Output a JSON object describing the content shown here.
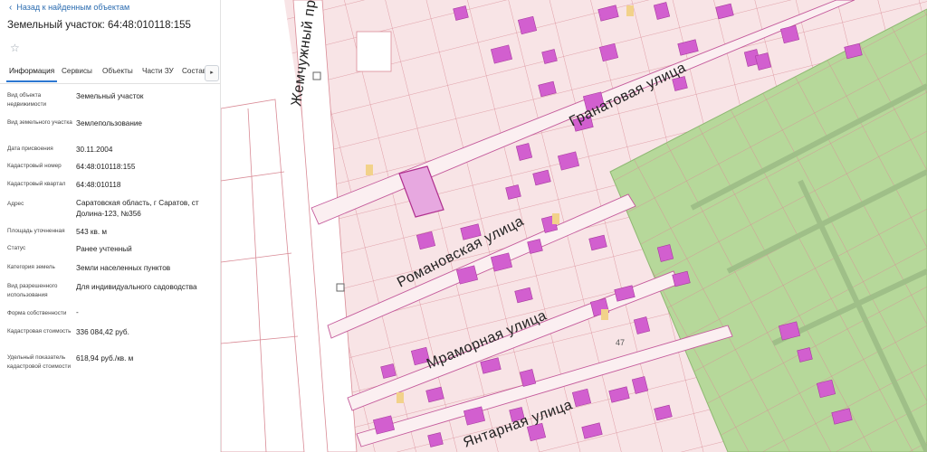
{
  "nav": {
    "back_label": "Назад к найденным объектам"
  },
  "header": {
    "title": "Земельный участок: 64:48:010118:155",
    "favorite_icon": "star-icon"
  },
  "tabs": [
    {
      "label": "Информация",
      "active": true
    },
    {
      "label": "Сервисы"
    },
    {
      "label": "Объекты"
    },
    {
      "label": "Части ЗУ"
    },
    {
      "label": "Состав"
    }
  ],
  "tabs_scroll_icon": "chevron-right-icon",
  "info": {
    "object_type": {
      "label": "Вид объекта недвижимости",
      "value": "Земельный участок"
    },
    "land_type": {
      "label": "Вид земельного участка",
      "value": "Землепользование"
    },
    "assign_date": {
      "label": "Дата присвоения",
      "value": "30.11.2004"
    },
    "cad_number": {
      "label": "Кадастровый номер",
      "value": "64:48:010118:155"
    },
    "cad_quarter": {
      "label": "Кадастровый квартал",
      "value": "64:48:010118"
    },
    "address": {
      "label": "Адрес",
      "value": "Саратовская область, г Саратов, ст Долина-123, №356"
    },
    "area": {
      "label": "Площадь уточненная",
      "value": "543 кв. м"
    },
    "status": {
      "label": "Статус",
      "value": "Ранее учтенный"
    },
    "land_category": {
      "label": "Категория земель",
      "value": "Земли населенных пунктов"
    },
    "permitted_use": {
      "label": "Вид разрешенного использования",
      "value": "Для индивидуального садоводства"
    },
    "ownership_form": {
      "label": "Форма собственности",
      "value": "-"
    },
    "cad_value": {
      "label": "Кадастровая стоимость",
      "value": "336 084,42 руб."
    },
    "specific_value": {
      "label": "Удельный показатель кадастровой стоимости",
      "value": "618,94 руб./кв. м"
    }
  },
  "map": {
    "streets": {
      "zhemchuzhny": "Жемчужный пр",
      "granatovaya": "Гранатовая улица",
      "romanovskaya": "Романовская улица",
      "mramornaya": "Мраморная улица",
      "yantarnaya": "Янтарная улица"
    },
    "parcel_number": "47",
    "colors": {
      "parcel_fill": "#f8e4e6",
      "parcel_line": "#d98b96",
      "building": "#d25fcf",
      "road": "#ffffff",
      "green_zone": "#b6d89a",
      "selected": "#d97fd4",
      "highlight": "#f2d28a"
    }
  }
}
